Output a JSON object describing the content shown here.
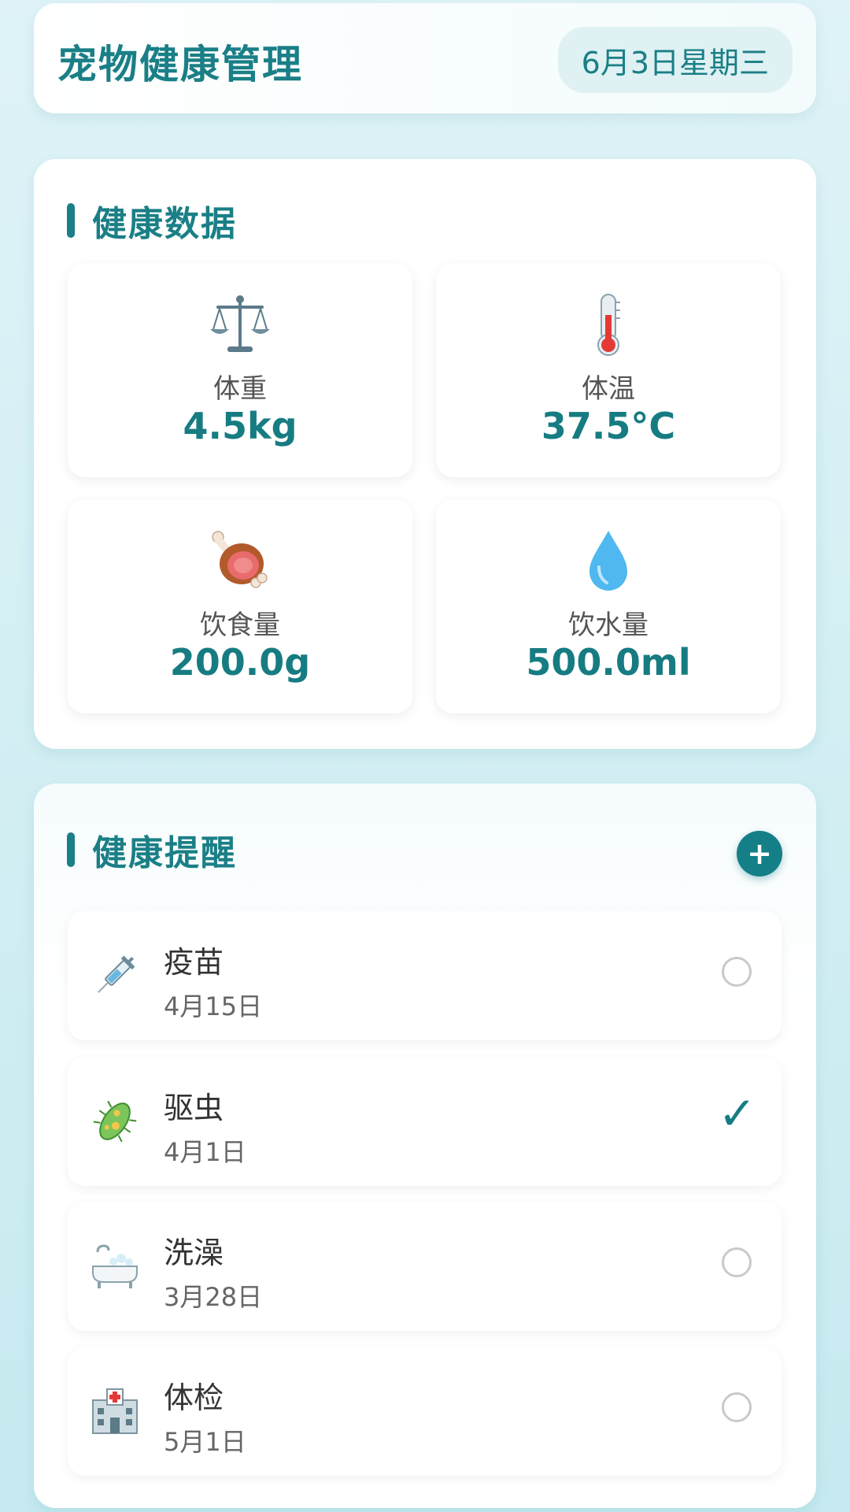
{
  "header": {
    "title": "宠物健康管理",
    "date": "6月3日星期三"
  },
  "health_data": {
    "section_title": "健康数据",
    "stats": [
      {
        "label": "体重",
        "value": "4.5kg",
        "icon": "scale-icon"
      },
      {
        "label": "体温",
        "value": "37.5°C",
        "icon": "thermometer-icon"
      },
      {
        "label": "饮食量",
        "value": "200.0g",
        "icon": "meat-icon"
      },
      {
        "label": "饮水量",
        "value": "500.0ml",
        "icon": "water-drop-icon"
      }
    ]
  },
  "reminders": {
    "section_title": "健康提醒",
    "add_label": "+",
    "items": [
      {
        "title": "疫苗",
        "date": "4月15日",
        "icon": "syringe-icon",
        "done": false
      },
      {
        "title": "驱虫",
        "date": "4月1日",
        "icon": "microbe-icon",
        "done": true,
        "check": "✓"
      },
      {
        "title": "洗澡",
        "date": "3月28日",
        "icon": "bathtub-icon",
        "done": false
      },
      {
        "title": "体检",
        "date": "5月1日",
        "icon": "hospital-icon",
        "done": false
      }
    ]
  },
  "colors": {
    "accent": "#1a7f86",
    "background": "#c6eaf0"
  }
}
